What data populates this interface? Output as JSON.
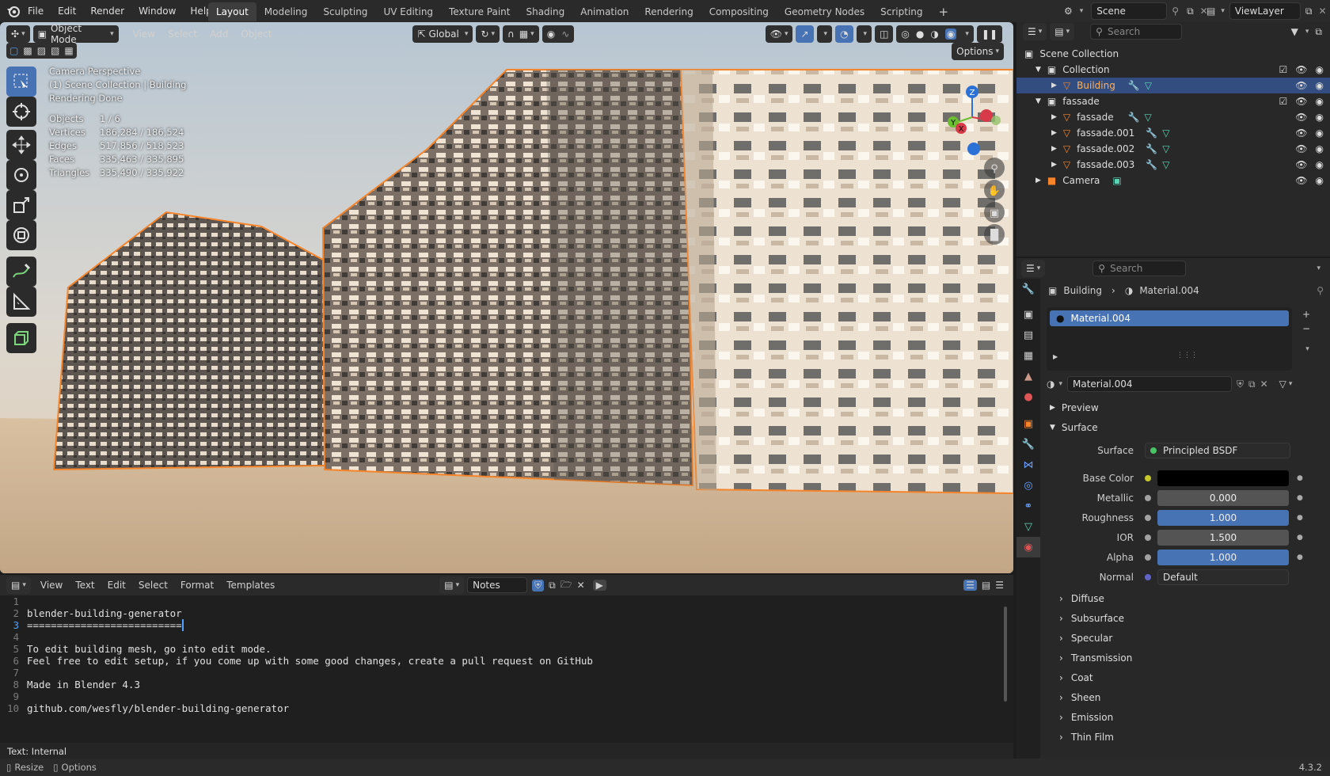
{
  "topbar": {
    "menu": [
      "File",
      "Edit",
      "Render",
      "Window",
      "Help"
    ],
    "workspaces": [
      "Layout",
      "Modeling",
      "Sculpting",
      "UV Editing",
      "Texture Paint",
      "Shading",
      "Animation",
      "Rendering",
      "Compositing",
      "Geometry Nodes",
      "Scripting"
    ],
    "active_workspace": "Layout",
    "add_tab": "+",
    "scene": "Scene",
    "view_layer": "ViewLayer"
  },
  "viewport": {
    "mode": "Object Mode",
    "menus": [
      "View",
      "Select",
      "Add",
      "Object"
    ],
    "orientation": "Global",
    "options": "Options",
    "overlay_lines": [
      "Camera Perspective",
      "(1) Scene Collection | Building",
      "Rendering Done"
    ],
    "stats": [
      {
        "k": "Objects",
        "v": "1 / 6"
      },
      {
        "k": "Vertices",
        "v": "186,284 / 186,524"
      },
      {
        "k": "Edges",
        "v": "517,856 / 518,523"
      },
      {
        "k": "Faces",
        "v": "335,463 / 335,895"
      },
      {
        "k": "Triangles",
        "v": "335,490 / 335,922"
      }
    ],
    "gizmo_axes": [
      "Z",
      "Y",
      "X"
    ]
  },
  "text_editor": {
    "menus": [
      "View",
      "Text",
      "Edit",
      "Select",
      "Format",
      "Templates"
    ],
    "text_name": "Notes",
    "lines": [
      {
        "n": "1",
        "t": ""
      },
      {
        "n": "2",
        "t": "blender-building-generator"
      },
      {
        "n": "3",
        "t": "=========================="
      },
      {
        "n": "4",
        "t": ""
      },
      {
        "n": "5",
        "t": "To edit building mesh, go into edit mode."
      },
      {
        "n": "6",
        "t": "Feel free to edit setup, if you come up with some good changes, create a pull request on GitHub"
      },
      {
        "n": "7",
        "t": ""
      },
      {
        "n": "8",
        "t": "Made in Blender 4.3"
      },
      {
        "n": "9",
        "t": ""
      },
      {
        "n": "10",
        "t": "github.com/wesfly/blender-building-generator"
      }
    ],
    "footer": "Text: Internal"
  },
  "outliner": {
    "search_placeholder": "Search",
    "root": "Scene Collection",
    "items": [
      {
        "label": "Collection",
        "indent": 1
      },
      {
        "label": "Building",
        "indent": 2
      },
      {
        "label": "fassade",
        "indent": 1
      },
      {
        "label": "fassade",
        "indent": 2
      },
      {
        "label": "fassade.001",
        "indent": 2
      },
      {
        "label": "fassade.002",
        "indent": 2
      },
      {
        "label": "fassade.003",
        "indent": 2
      },
      {
        "label": "Camera",
        "indent": 1
      }
    ]
  },
  "properties": {
    "search_placeholder": "Search",
    "breadcrumb_object": "Building",
    "breadcrumb_material": "Material.004",
    "slot": "Material.004",
    "material_name": "Material.004",
    "sections": {
      "preview": "Preview",
      "surface": "Surface"
    },
    "surface_label": "Surface",
    "surface_value": "Principled BSDF",
    "params": [
      {
        "label": "Base Color",
        "value": "",
        "type": "color",
        "sock": "#c7c729"
      },
      {
        "label": "Metallic",
        "value": "0.000",
        "type": "slider",
        "sock": "#a1a1a1",
        "blue": false
      },
      {
        "label": "Roughness",
        "value": "1.000",
        "type": "slider",
        "sock": "#a1a1a1",
        "blue": true
      },
      {
        "label": "IOR",
        "value": "1.500",
        "type": "slider",
        "sock": "#a1a1a1",
        "blue": false
      },
      {
        "label": "Alpha",
        "value": "1.000",
        "type": "slider",
        "sock": "#a1a1a1",
        "blue": true
      },
      {
        "label": "Normal",
        "value": "Default",
        "type": "field",
        "sock": "#6363c7"
      }
    ],
    "subpanels": [
      "Diffuse",
      "Subsurface",
      "Specular",
      "Transmission",
      "Coat",
      "Sheen",
      "Emission",
      "Thin Film"
    ]
  },
  "statusbar": {
    "resize": "Resize",
    "options": "Options",
    "version": "4.3.2"
  },
  "colors": {
    "accent": "#4772b3",
    "selection_outline": "#f5842b",
    "background": "#1d1d1d"
  }
}
